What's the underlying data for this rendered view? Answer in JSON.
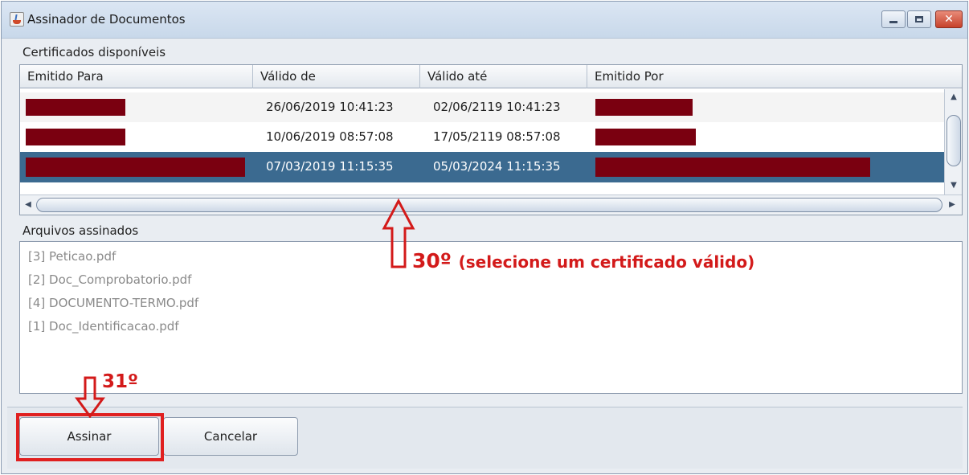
{
  "window": {
    "title": "Assinador de Documentos",
    "controls": [
      "minimize",
      "maximize",
      "close"
    ],
    "close_glyph": "✕"
  },
  "certificates": {
    "section_label": "Certificados disponíveis",
    "columns": [
      "Emitido Para",
      "Válido de",
      "Válido até",
      "Emitido Por"
    ],
    "rows": [
      {
        "emitido_para": "[redacted]",
        "valido_de": "26/06/2019 10:41:23",
        "valido_ate": "02/06/2119 10:41:23",
        "emitido_por": "[redacted]",
        "selected": false
      },
      {
        "emitido_para": "[redacted]",
        "valido_de": "10/06/2019 08:57:08",
        "valido_ate": "17/05/2119 08:57:08",
        "emitido_por": "[redacted]",
        "selected": false
      },
      {
        "emitido_para": "[redacted]",
        "valido_de": "07/03/2019 11:15:35",
        "valido_ate": "05/03/2024 11:15:35",
        "emitido_por": "[redacted]",
        "selected": true
      }
    ],
    "redaction_color": "#7a0010",
    "selection_color": "#3b6a90"
  },
  "signed_files": {
    "section_label": "Arquivos assinados",
    "items": [
      "[3] Peticao.pdf",
      "[2] Doc_Comprobatorio.pdf",
      "[4] DOCUMENTO-TERMO.pdf",
      "[1] Doc_Identificacao.pdf"
    ]
  },
  "buttons": {
    "sign_label": "Assinar",
    "cancel_label": "Cancelar"
  },
  "annotations": {
    "step30_number": "30º",
    "step30_text": "(selecione um certificado válido)",
    "step31_number": "31º",
    "color": "#d31a1a"
  }
}
